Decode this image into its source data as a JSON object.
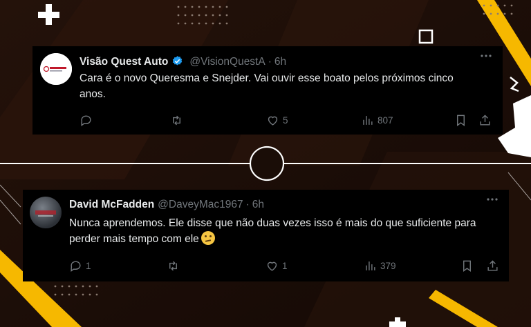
{
  "tweets": [
    {
      "author_name": "Visão Quest Auto",
      "handle": "@VisionQuestA",
      "separator": "·",
      "time": "6h",
      "verified": true,
      "text": "Cara é o novo Queresma e Snejder. Vai ouvir esse boato pelos próximos cinco anos.",
      "replies": "",
      "retweets": "",
      "likes": "5",
      "views": "807",
      "avatar": "visao-quest-auto-logo"
    },
    {
      "author_name": "David McFadden",
      "handle": "@DaveyMac1967",
      "separator": "·",
      "time": "6h",
      "verified": false,
      "text": "Nunca aprendemos. Ele disse que não duas vezes isso é mais do que suficiente para perder mais tempo com ele",
      "emoji": "thinking-face",
      "replies": "1",
      "retweets": "",
      "likes": "1",
      "views": "379",
      "avatar": "profile-photo"
    }
  ],
  "icons": [
    "reply-icon",
    "retweet-icon",
    "like-icon",
    "views-icon",
    "bookmark-icon",
    "share-icon",
    "more-icon",
    "verified-badge-icon"
  ],
  "colors": {
    "background": "#1a0d07",
    "accent_yellow": "#f6b800",
    "card": "#000000",
    "text_primary": "#e7e9ea",
    "text_secondary": "#71767b",
    "verified": "#1d9bf0"
  }
}
